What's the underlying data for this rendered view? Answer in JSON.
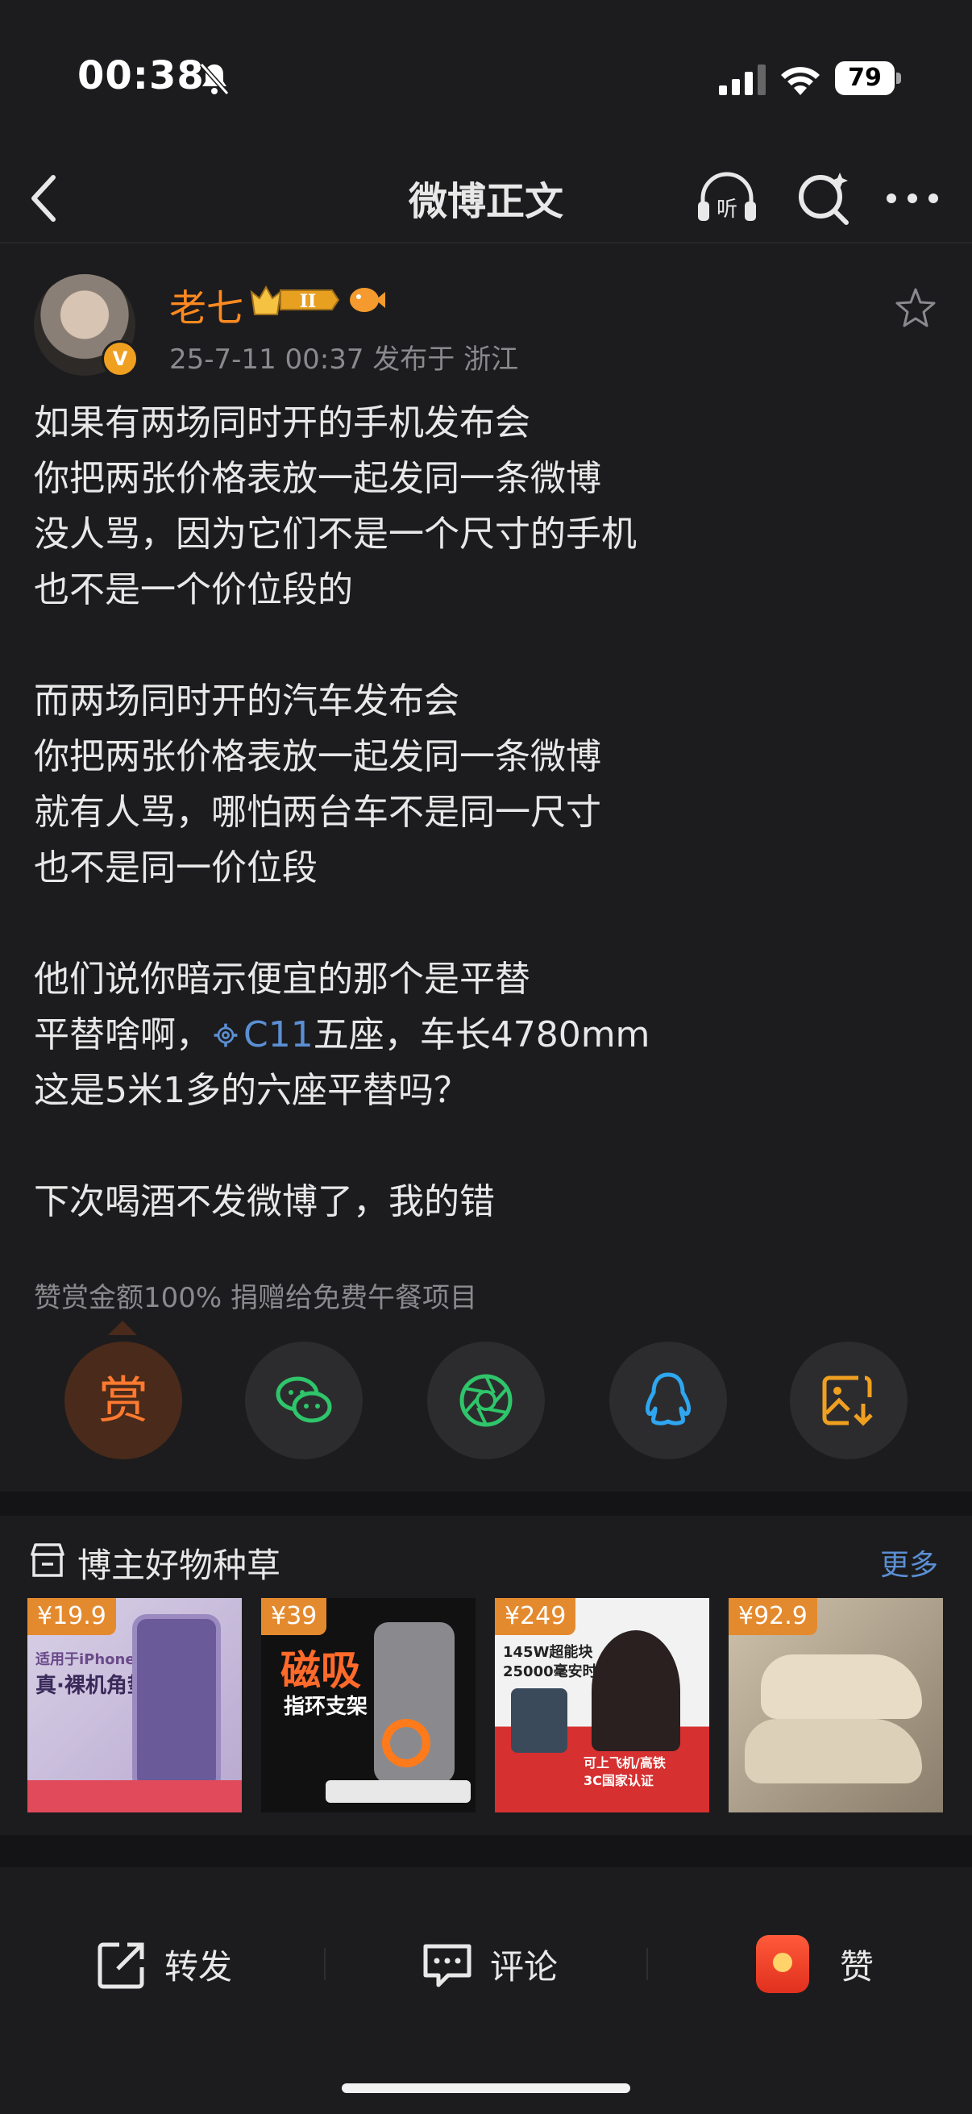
{
  "status": {
    "time": "00:38",
    "battery": "79"
  },
  "nav": {
    "title": "微博正文"
  },
  "author": {
    "name": "老七",
    "level_badge": "II",
    "verify_badge": "V",
    "meta": "25-7-11 00:37  发布于 浙江"
  },
  "post": {
    "p1": "如果有两场同时开的手机发布会\n你把两张价格表放一起发同一条微博\n没人骂，因为它们不是一个尺寸的手机\n也不是一个价位段的",
    "p2": "而两场同时开的汽车发布会\n你把两张价格表放一起发同一条微博\n就有人骂，哪怕两台车不是同一尺寸\n也不是同一价位段",
    "p3_line1": "他们说你暗示便宜的那个是平替",
    "p3_line2_pre": "平替啥啊，",
    "p3_line2_link": "C11",
    "p3_line2_post": "五座，车长4780mm",
    "p3_line3": "这是5米1多的六座平替吗？",
    "p4": "下次喝酒不发微博了，我的错"
  },
  "reward_note": "赞赏金额100% 捐赠给免费午餐项目",
  "actions": {
    "reward_char": "赏",
    "items": [
      "reward",
      "wechat",
      "moments",
      "qq",
      "save-image"
    ]
  },
  "goods": {
    "title": "博主好物种草",
    "more": "更多",
    "items": [
      {
        "price": "¥19.9",
        "caption": "真·裸机角垫",
        "sub": "适用于iPhone系列"
      },
      {
        "price": "¥39",
        "caption": "磁吸",
        "sub": "指环支架"
      },
      {
        "price": "¥249",
        "caption": "145W超能块\n25000毫安时",
        "sub": "可上飞机/高铁\n3C国家认证"
      },
      {
        "price": "¥92.9",
        "caption": "",
        "sub": ""
      }
    ]
  },
  "bottom": {
    "repost": "转发",
    "comment": "评论",
    "like": "赞"
  },
  "colors": {
    "background": "#1c1c1e",
    "accent_orange": "#ff8a20",
    "link_blue": "#5b8fd4",
    "muted": "#8a8a8e"
  }
}
